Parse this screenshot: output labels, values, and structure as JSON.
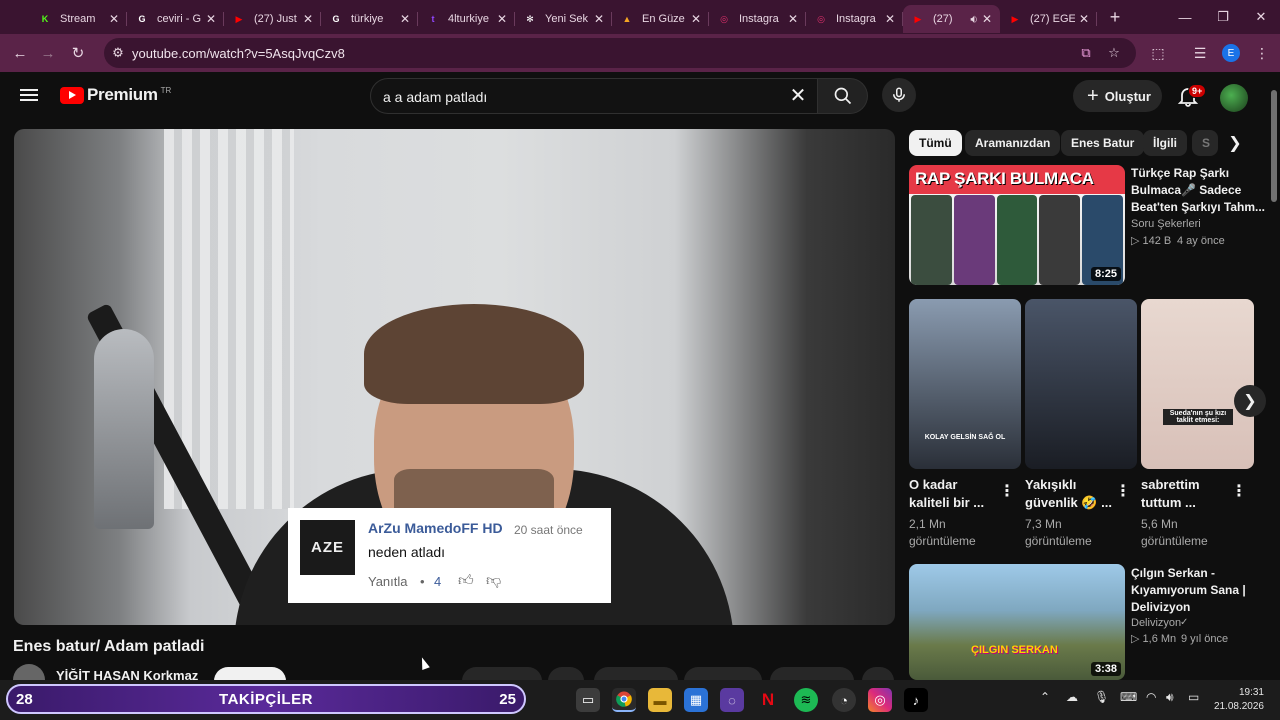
{
  "browser": {
    "tabs": [
      {
        "title": "Stream",
        "icon": "kick-icon",
        "color": "#53fc18",
        "glyph": "K"
      },
      {
        "title": "ceviri - G",
        "icon": "google-icon",
        "color": "#ffffff",
        "glyph": "G"
      },
      {
        "title": "(27) Just",
        "icon": "youtube-icon",
        "color": "#ff0000",
        "glyph": "▶"
      },
      {
        "title": "türkiye",
        "icon": "google-icon",
        "color": "#ffffff",
        "glyph": "G"
      },
      {
        "title": "4lturkiye",
        "icon": "twitch-icon",
        "color": "#9146ff",
        "glyph": "t"
      },
      {
        "title": "Yeni Sek",
        "icon": "openai-icon",
        "color": "#ffffff",
        "glyph": "✻"
      },
      {
        "title": "En Güze",
        "icon": "rainbow-icon",
        "color": "#f5a623",
        "glyph": "▲"
      },
      {
        "title": "Instagra",
        "icon": "instagram-icon",
        "color": "#e1306c",
        "glyph": "◎"
      },
      {
        "title": "Instagra",
        "icon": "instagram-icon",
        "color": "#e1306c",
        "glyph": "◎"
      },
      {
        "title": "(27)",
        "icon": "youtube-icon",
        "color": "#ff0000",
        "glyph": "▶",
        "active": true
      },
      {
        "title": "(27) EGE",
        "icon": "youtube-icon",
        "color": "#ff0000",
        "glyph": "▶"
      }
    ],
    "url": "youtube.com/watch?v=5AsqJvqCzv8",
    "profile_letter": "E"
  },
  "youtube": {
    "logo_word": "Premium",
    "logo_region": "TR",
    "search_value": "a a adam patladı",
    "create_label": "Oluştur",
    "bell_badge": "9+"
  },
  "comment": {
    "avatar_text": "AZE",
    "author": "ArZu MamedoFF HD",
    "time": "20 saat önce",
    "text": "neden atladı",
    "reply_label": "Yanıtla",
    "separator": "•",
    "likes": "4"
  },
  "video": {
    "title": "Enes batur/ Adam patladi",
    "channel": "YİĞİT HASAN Korkmaz"
  },
  "chips": [
    "Tümü",
    "Aramanızdan",
    "Enes Batur",
    "İlgili",
    "S"
  ],
  "recommended": [
    {
      "thumb_text": "RAP ŞARKI BULMACA",
      "title_line1": "Türkçe Rap Şarkı",
      "title_line2": "Bulmaca🎤 Sadece",
      "title_line3": "Beat'ten Şarkıyı Tahm...",
      "channel": "Soru Şekerleri",
      "views": "▷ 142 B",
      "age": "4 ay önce",
      "duration": "8:25"
    },
    {
      "title_line1": "Çılgın Serkan -",
      "title_line2": "Kıyamıyorum Sana |",
      "title_line3": "Delivizyon",
      "channel": "Delivizyon",
      "verified": "✓",
      "views": "▷ 1,6 Mn",
      "age": "9 yıl önce",
      "duration": "3:38",
      "thumb_text": "ÇILGIN SERKAN"
    }
  ],
  "shorts": [
    {
      "title_line1": "O kadar",
      "title_line2": "kaliteli bir ...",
      "views": "2,1 Mn",
      "views_unit": "görüntüleme",
      "overlay": "KOLAY GELSİN SAĞ OL"
    },
    {
      "title_line1": "Yakışıklı",
      "title_line2": "güvenlik 🤣 ...",
      "views": "7,3 Mn",
      "views_unit": "görüntüleme",
      "overlay": ""
    },
    {
      "title_line1": "sabrettim",
      "title_line2": "tuttum ...",
      "views": "5,6 Mn",
      "views_unit": "görüntüleme",
      "overlay": "Sueda'nın şu kızı taklit etmesi:"
    }
  ],
  "taskbar": {
    "left_count": "28",
    "label": "TAKİPÇİLER",
    "right_count": "25",
    "time": "19:31",
    "date": "21.08.2026"
  },
  "colors": {
    "accent": "#ff0000",
    "browser_frame": "#5a2348",
    "tabstrip": "#3a1430",
    "page_bg": "#0f0f0f"
  }
}
